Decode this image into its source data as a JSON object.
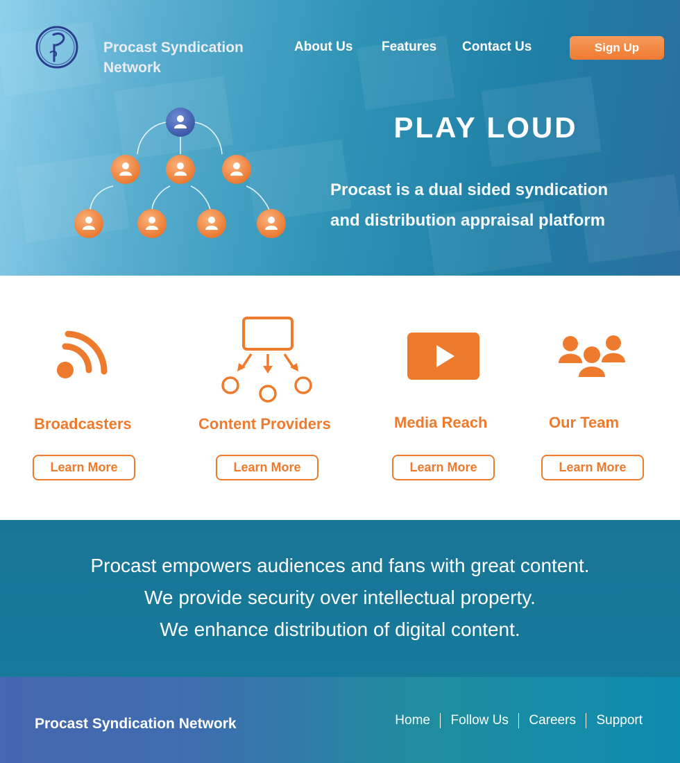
{
  "brand": {
    "name_line1": "Procast Syndication",
    "name_line2": "Network"
  },
  "nav": {
    "about": "About Us",
    "features": "Features",
    "contact": "Contact Us",
    "signup": "Sign Up"
  },
  "hero": {
    "title": "PLAY LOUD",
    "subtitle_line1": "Procast is a dual sided syndication",
    "subtitle_line2": "and distribution appraisal platform"
  },
  "features": [
    {
      "label": "Broadcasters",
      "button": "Learn More",
      "icon": "rss-icon"
    },
    {
      "label": "Content Providers",
      "button": "Learn More",
      "icon": "distribution-diagram-icon"
    },
    {
      "label": "Media Reach",
      "button": "Learn More",
      "icon": "play-video-icon"
    },
    {
      "label": "Our Team",
      "button": "Learn More",
      "icon": "team-people-icon"
    }
  ],
  "mission": {
    "line1": "Procast empowers audiences and fans with great content.",
    "line2": "We provide security over intellectual property.",
    "line3": "We enhance distribution of digital content."
  },
  "footer": {
    "brand": "Procast Syndication Network",
    "links": [
      "Home",
      "Follow Us",
      "Careers",
      "Support"
    ]
  },
  "colors": {
    "accent": "#ee7a2d",
    "teal": "#167a9b",
    "navy_node": "#3f5fa8"
  }
}
